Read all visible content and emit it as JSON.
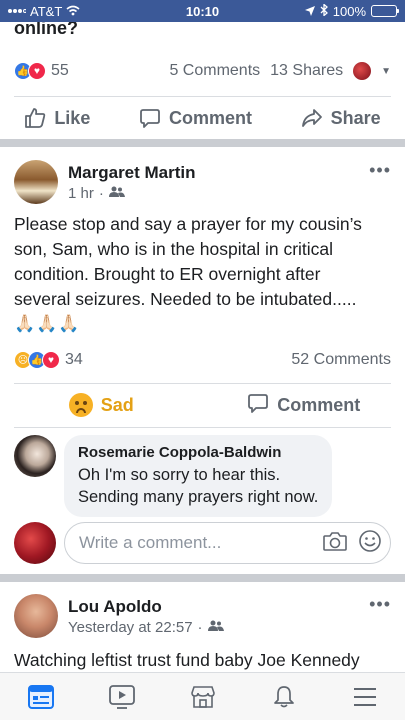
{
  "status": {
    "carrier": "AT&T",
    "time": "10:10",
    "battery": "100%"
  },
  "prev_post": {
    "title_fragment": "online?",
    "reaction_count": "55",
    "comments": "5 Comments",
    "shares": "13 Shares"
  },
  "actions": {
    "like": "Like",
    "comment": "Comment",
    "share": "Share"
  },
  "post1": {
    "author": "Margaret Martin",
    "time": "1 hr",
    "text_lines": [
      "Please stop and say a prayer for my cousin’s",
      "son, Sam, who is in the hospital in critical",
      "condition. Brought to ER overnight after",
      "several seizures. Needed to be intubated....."
    ],
    "emojis": "🙏🏻🙏🏻🙏🏻",
    "reaction_count": "34",
    "comments": "52 Comments",
    "sad_label": "Sad",
    "comment_label": "Comment"
  },
  "comment1": {
    "author": "Rosemarie Coppola-Baldwin",
    "text_line1": "Oh I'm so sorry to hear this.",
    "text_line2": "Sending many prayers right now."
  },
  "write_comment": {
    "placeholder": "Write a comment..."
  },
  "post2": {
    "author": "Lou Apoldo",
    "time": "Yesterday at 22:57",
    "text_line1": "Watching leftist trust fund baby Joe Kennedy"
  },
  "colors": {
    "fb_blue": "#3b5998",
    "like_blue": "#3578e5",
    "love_red": "#f0284a",
    "sad_yellow": "#f7b125"
  },
  "tabs": [
    "news-feed-icon",
    "watch-icon",
    "marketplace-icon",
    "notifications-icon",
    "menu-icon"
  ]
}
